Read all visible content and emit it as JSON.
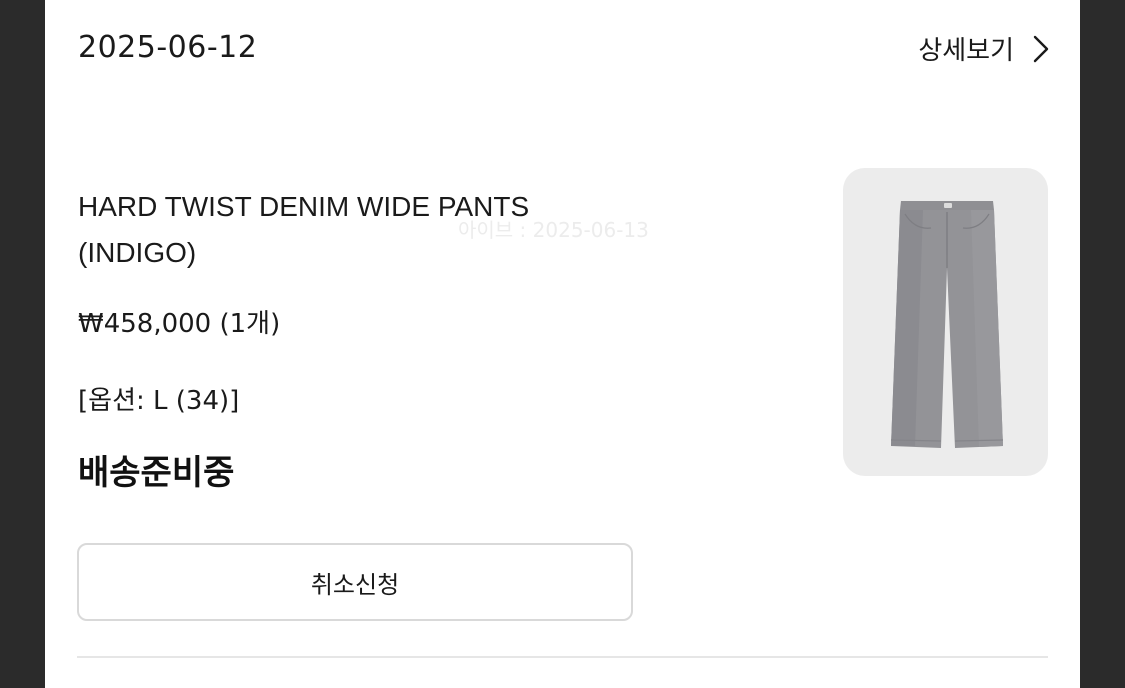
{
  "order": {
    "date": "2025-06-12",
    "detail_link_label": "상세보기",
    "detail_icon": "chevron-right-icon"
  },
  "product": {
    "name_line1": "HARD TWIST DENIM WIDE PANTS",
    "name_line2": "(INDIGO)",
    "price": "₩458,000 (1개)",
    "option": "[옵션: L (34)]",
    "status": "배송준비중",
    "image": "denim-wide-pants-image"
  },
  "watermark": "아이브 : 2025-06-13",
  "actions": {
    "cancel_label": "취소신청"
  },
  "colors": {
    "background": "#2b2b2b",
    "card": "#ffffff",
    "thumbnail_bg": "#ececec",
    "button_border": "#d9d9d9"
  }
}
